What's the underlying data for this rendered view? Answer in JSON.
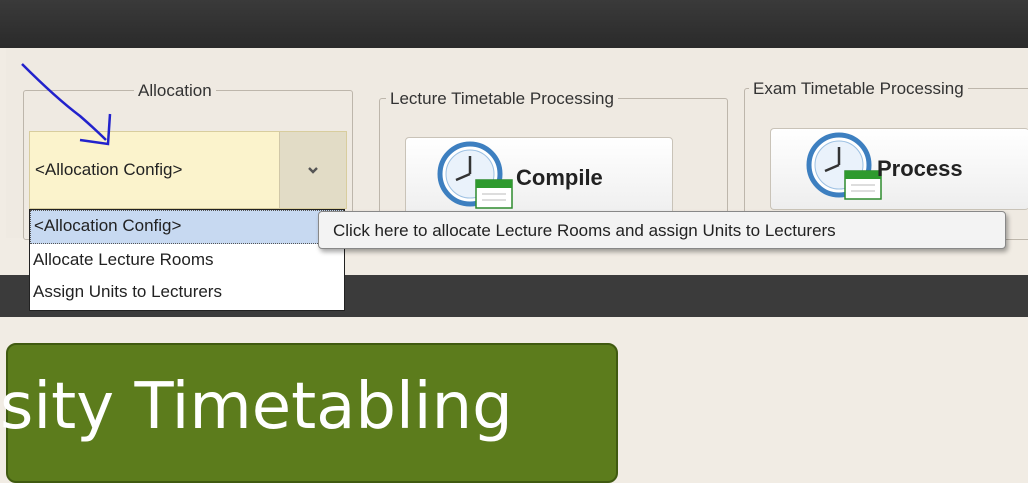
{
  "ribbon": {
    "allocation": {
      "title": "Allocation",
      "combo_value": "<Allocation Config>",
      "dropdown_items": [
        "<Allocation Config>",
        "Allocate Lecture Rooms",
        "Assign Units to Lecturers"
      ],
      "tooltip": "Click here to allocate Lecture Rooms and assign Units to Lecturers"
    },
    "lecture": {
      "title": "Lecture Timetable Processing",
      "button_label": "Compile"
    },
    "exam": {
      "title": "Exam Timetable Processing",
      "button_label": "Process"
    }
  },
  "banner": {
    "text": "sity Timetabling"
  },
  "colors": {
    "banner_green": "#5c7c1c",
    "combo_yellow": "#fbf3cc",
    "annotation_blue": "#2222cc"
  },
  "icons": {
    "button_icon": "calendar-clock-icon",
    "combo_arrow": "chevron-down-icon",
    "annotation": "hand-drawn-arrow-icon"
  }
}
